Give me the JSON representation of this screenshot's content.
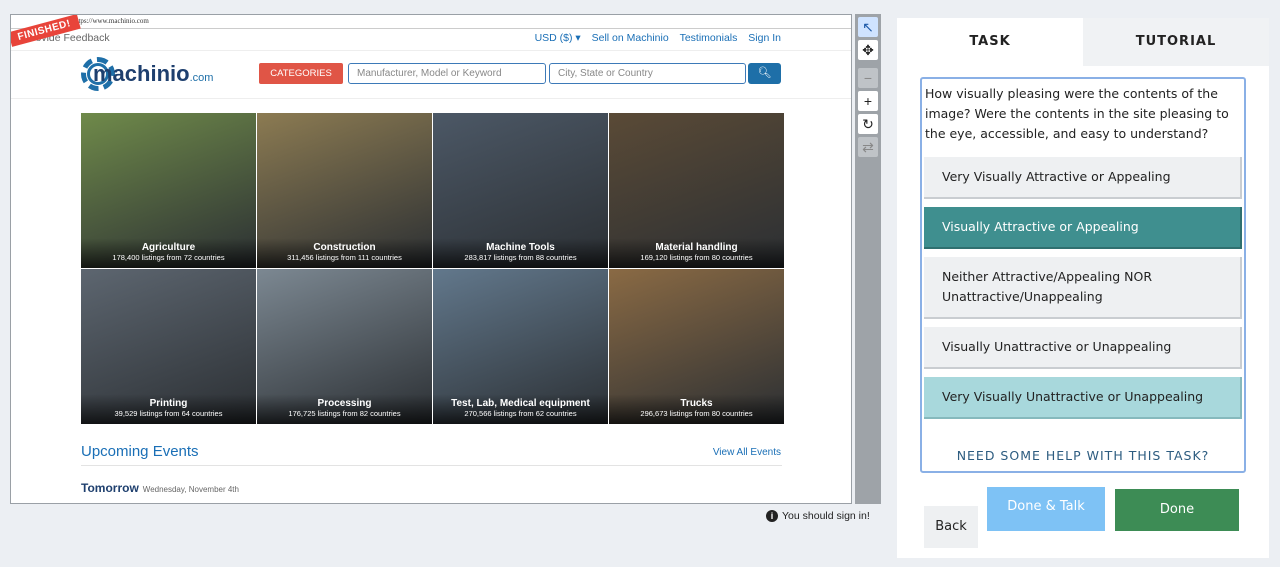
{
  "viewer": {
    "url": "https://www.machinio.com",
    "finished_label": "FINISHED!",
    "topnav": {
      "feedback": "Provide Feedback",
      "currency": "USD ($) ▾",
      "sell": "Sell on Machinio",
      "testimonials": "Testimonials",
      "signin": "Sign In"
    },
    "logo": {
      "text": "machinio",
      "suffix": ".com"
    },
    "search": {
      "categories_label": "CATEGORIES",
      "keyword_placeholder": "Manufacturer, Model or Keyword",
      "location_placeholder": "City, State or Country",
      "search_icon": "search-icon"
    },
    "tiles": [
      {
        "title": "Agriculture",
        "sub": "178,400 listings from 72 countries",
        "bg": "#6f8a4a"
      },
      {
        "title": "Construction",
        "sub": "311,456 listings from 111 countries",
        "bg": "#8c7b52"
      },
      {
        "title": "Machine Tools",
        "sub": "283,817 listings from 88 countries",
        "bg": "#4c5866"
      },
      {
        "title": "Material handling",
        "sub": "169,120 listings from 80 countries",
        "bg": "#5a4a36"
      },
      {
        "title": "Printing",
        "sub": "39,529 listings from 64 countries",
        "bg": "#5d6670"
      },
      {
        "title": "Processing",
        "sub": "176,725 listings from 82 countries",
        "bg": "#7c8892"
      },
      {
        "title": "Test, Lab, Medical equipment",
        "sub": "270,566 listings from 62 countries",
        "bg": "#62788c"
      },
      {
        "title": "Trucks",
        "sub": "296,673 listings from 80 countries",
        "bg": "#8a6a44"
      }
    ],
    "events": {
      "title": "Upcoming Events",
      "view_all": "View All Events",
      "tomorrow": "Tomorrow",
      "date": "Wednesday, November 4th"
    }
  },
  "toolbar": [
    "pointer-icon",
    "move-icon",
    "zoom-out-icon",
    "zoom-in-icon",
    "rotate-icon",
    "refresh-icon"
  ],
  "signin_note": "You should sign in!",
  "panel": {
    "tabs": [
      "TASK",
      "TUTORIAL"
    ],
    "question": "How visually pleasing were the contents of the image? Were the contents in the site pleasing to the eye, accessible, and easy to understand?",
    "options": [
      "Very Visually Attractive or Appealing",
      "Visually Attractive or Appealing",
      "Neither Attractive/Appealing NOR Unattractive/Unappealing",
      "Visually Unattractive or Unappealing",
      "Very Visually Unattractive or Unappealing"
    ],
    "selected_index": 1,
    "need_help": "NEED SOME HELP WITH THIS TASK?",
    "buttons": {
      "back": "Back",
      "done_talk": "Done & Talk",
      "done": "Done"
    }
  }
}
